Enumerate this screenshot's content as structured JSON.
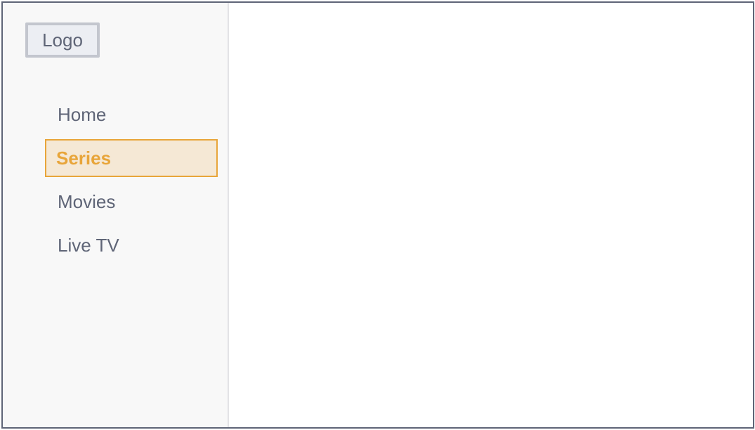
{
  "logo": {
    "label": "Logo"
  },
  "nav": {
    "items": [
      {
        "label": "Home",
        "active": false
      },
      {
        "label": "Series",
        "active": true
      },
      {
        "label": "Movies",
        "active": false
      },
      {
        "label": "Live TV",
        "active": false
      }
    ]
  },
  "colors": {
    "frame_border": "#5f6577",
    "sidebar_bg": "#f8f8f8",
    "text": "#5f6577",
    "accent": "#e8a53a",
    "active_bg": "#f5e8d5",
    "logo_border": "#c3c6ce",
    "logo_bg": "#eceef3"
  }
}
